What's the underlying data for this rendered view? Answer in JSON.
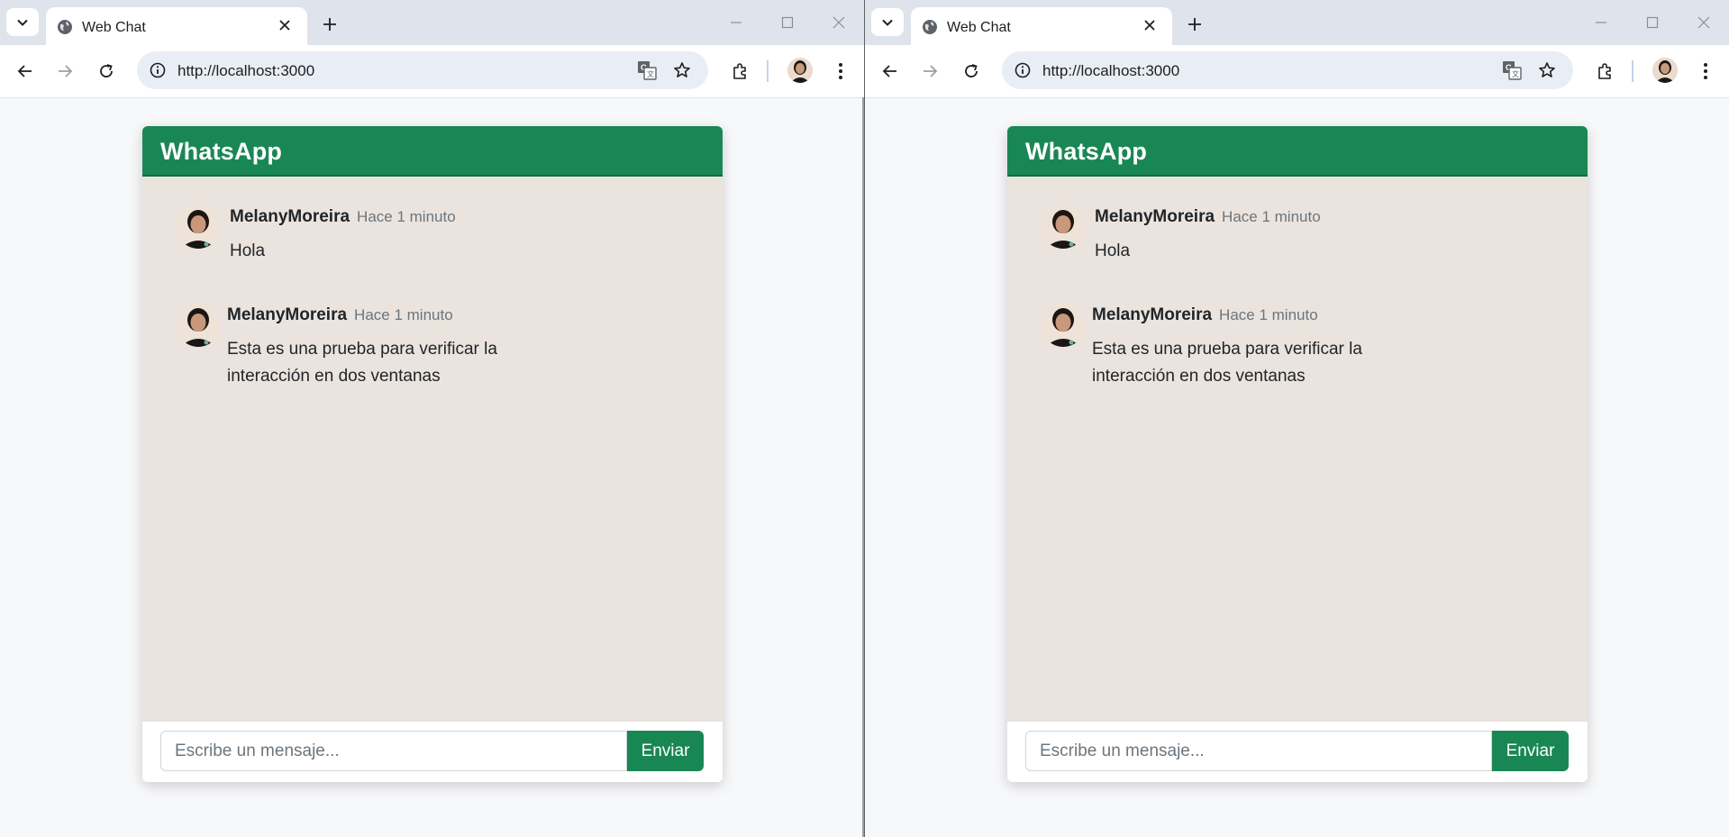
{
  "windows": [
    {
      "tab": {
        "title": "Web Chat"
      },
      "address": {
        "url": "http://localhost:3000"
      },
      "app": {
        "title": "WhatsApp",
        "messages": [
          {
            "user": "MelanyMoreira",
            "time": "Hace 1 minuto",
            "text": "Hola"
          },
          {
            "user": "MelanyMoreira",
            "time": "Hace 1 minuto",
            "text": "Esta es una prueba para verificar la interacción en dos ventanas"
          }
        ],
        "compose": {
          "placeholder": "Escribe un mensaje...",
          "send_label": "Enviar"
        }
      }
    },
    {
      "tab": {
        "title": "Web Chat"
      },
      "address": {
        "url": "http://localhost:3000"
      },
      "app": {
        "title": "WhatsApp",
        "messages": [
          {
            "user": "MelanyMoreira",
            "time": "Hace 1 minuto",
            "text": "Hola"
          },
          {
            "user": "MelanyMoreira",
            "time": "Hace 1 minuto",
            "text": "Esta es una prueba para verificar la interacción en dos ventanas"
          }
        ],
        "compose": {
          "placeholder": "Escribe un mensaje...",
          "send_label": "Enviar"
        }
      }
    }
  ],
  "colors": {
    "accent": "#198754",
    "chat_background": "#ebe4de"
  },
  "icons": [
    "tab-search-icon",
    "globe-icon",
    "close-icon",
    "plus-icon",
    "minimize-icon",
    "maximize-icon",
    "back-arrow-icon",
    "forward-arrow-icon",
    "reload-icon",
    "site-info-icon",
    "translate-icon",
    "star-icon",
    "extensions-icon",
    "menu-dots-icon"
  ]
}
